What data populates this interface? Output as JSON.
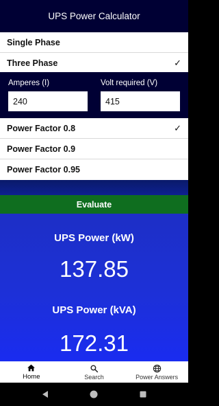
{
  "app": {
    "title": "UPS Power Calculator"
  },
  "phase_options": [
    {
      "label": "Single Phase",
      "selected": false
    },
    {
      "label": "Three Phase",
      "selected": true
    }
  ],
  "check_mark": "✓",
  "inputs": {
    "amperes": {
      "label": "Amperes (I)",
      "value": "240"
    },
    "volts": {
      "label": "Volt required (V)",
      "value": "415"
    }
  },
  "power_factor_options": [
    {
      "label": "Power Factor 0.8",
      "selected": true
    },
    {
      "label": "Power Factor 0.9",
      "selected": false
    },
    {
      "label": "Power Factor 0.95",
      "selected": false
    }
  ],
  "evaluate_label": "Evaluate",
  "results": {
    "kw_title": "UPS Power (kW)",
    "kw_value": "137.85",
    "kva_title": "UPS Power (kVA)",
    "kva_value": "172.31"
  },
  "bottom_nav": [
    {
      "label": "Home",
      "icon": "home-icon",
      "active": true
    },
    {
      "label": "Search",
      "icon": "search-icon",
      "active": false
    },
    {
      "label": "Power Answers",
      "icon": "globe-icon",
      "active": false
    }
  ],
  "colors": {
    "header": "#000034",
    "evaluate": "#0f6e1f",
    "results_gradient": [
      "#1d2fc6",
      "#1a2cf0"
    ]
  }
}
